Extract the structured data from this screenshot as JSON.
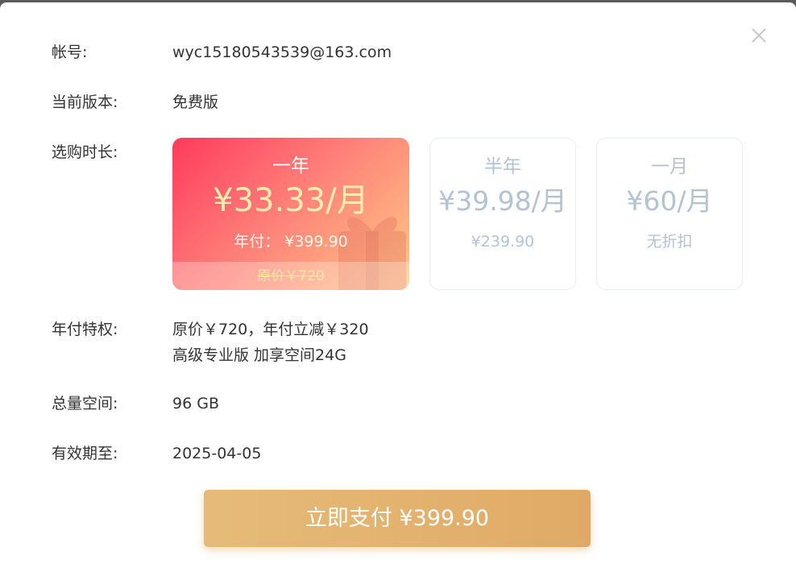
{
  "account": {
    "label": "帐号:",
    "value": "wyc15180543539@163.com"
  },
  "current_version": {
    "label": "当前版本:",
    "value": "免费版"
  },
  "duration": {
    "label": "选购时长:",
    "plans": [
      {
        "name": "一年",
        "price": "¥33.33/月",
        "sub": "年付：  ¥399.90",
        "original": "原价￥720",
        "selected": true
      },
      {
        "name": "半年",
        "price": "¥39.98/月",
        "sub": "¥239.90",
        "selected": false
      },
      {
        "name": "一月",
        "price": "¥60/月",
        "sub": "无折扣",
        "selected": false
      }
    ]
  },
  "privileges": {
    "label": "年付特权:",
    "line1": "原价￥720，年付立减￥320",
    "line2": "高级专业版 加享空间24G"
  },
  "total_space": {
    "label": "总量空间:",
    "value": "96 GB"
  },
  "valid_until": {
    "label": "有效期至:",
    "value": "2025-04-05"
  },
  "pay_button": {
    "label": "立即支付 ¥399.90"
  },
  "colors": {
    "accent_gold": "#e0aa66",
    "selected_card_start": "#ff3a5c",
    "selected_card_end": "#ffc985",
    "muted_card_text": "#b3c3d4"
  },
  "icons": {
    "close": "close-icon",
    "gift": "gift-icon"
  }
}
